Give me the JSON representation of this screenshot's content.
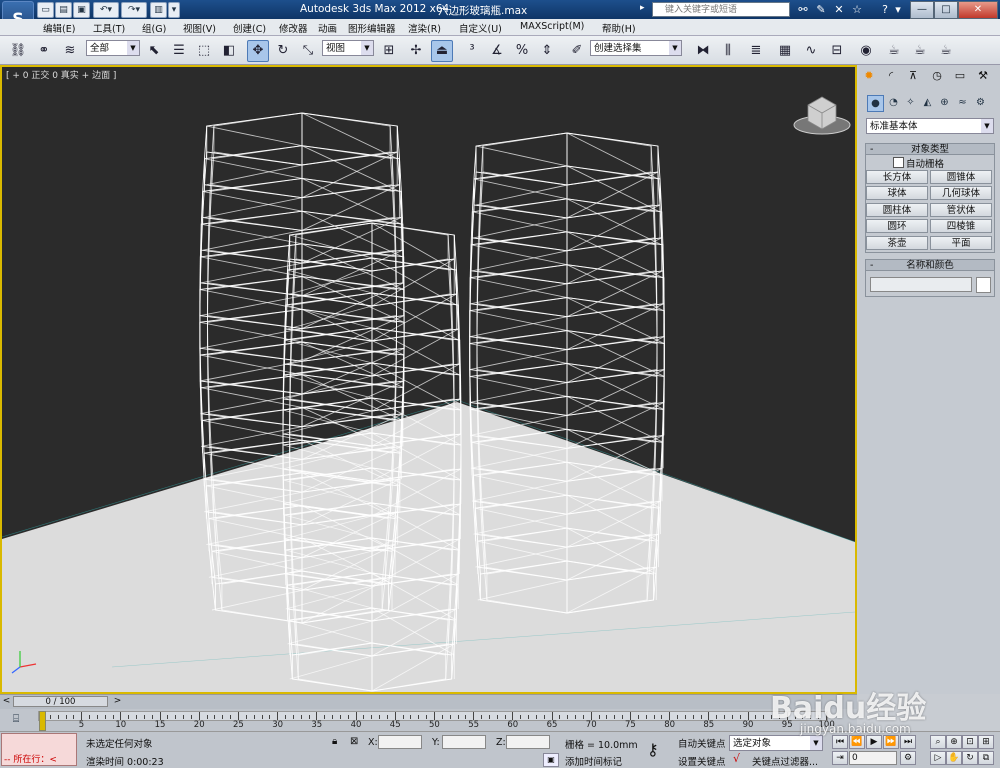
{
  "app": {
    "title": "Autodesk 3ds Max  2012 x64",
    "filename": "六边形玻璃瓶.max",
    "logo_letter": "S",
    "search_placeholder": "键入关键字或短语",
    "window_controls": [
      "—",
      "□",
      "✕"
    ]
  },
  "menu": [
    "编辑(E)",
    "工具(T)",
    "组(G)",
    "视图(V)",
    "创建(C)",
    "修改器",
    "动画",
    "图形编辑器",
    "渲染(R)",
    "自定义(U)",
    "MAXScript(M)",
    "帮助(H)"
  ],
  "toolbar": {
    "selection_filter": "全部",
    "coord_system": "视图",
    "named_selection": "创建选择集"
  },
  "viewport": {
    "label": "[ + 0 正交 0 真实 + 边面 ]"
  },
  "command_panel": {
    "category": "标准基本体",
    "object_type_title": "对象类型",
    "autogrid_label": "自动栅格",
    "buttons": [
      "长方体",
      "圆锥体",
      "球体",
      "几何球体",
      "圆柱体",
      "管状体",
      "圆环",
      "四棱锥",
      "茶壶",
      "平面"
    ],
    "name_color_title": "名称和颜色",
    "name_value": ""
  },
  "timeline": {
    "slider_text": "0 / 100",
    "ticks": [
      "0",
      "5",
      "10",
      "15",
      "20",
      "25",
      "30",
      "35",
      "40",
      "45",
      "50",
      "55",
      "60",
      "65",
      "70",
      "75",
      "80",
      "85",
      "90",
      "95",
      "100"
    ]
  },
  "status": {
    "script_text": "-- 所在行：<",
    "selection_status": "未选定任何对象",
    "render_time": "渲染时间  0:00:23",
    "x_label": "X:",
    "y_label": "Y:",
    "z_label": "Z:",
    "grid": "栅格 = 10.0mm",
    "add_time_tag": "添加时间标记",
    "auto_key": "自动关键点",
    "set_key": "设置关键点",
    "key_mode": "选定对象",
    "key_filters": "关键点过滤器...",
    "frame": "0"
  },
  "watermark": {
    "text": "Baidu经验",
    "url": "jingyan.baidu.com"
  },
  "colors": {
    "viewport_bg": "#2b2b2b",
    "viewport_border": "#d9b900",
    "title_bg": "#1d4f8c",
    "active_tool": "#a8c6ea"
  }
}
